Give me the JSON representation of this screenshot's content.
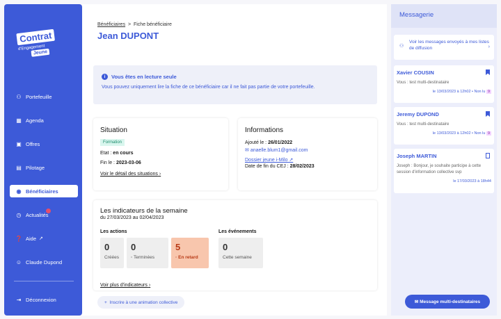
{
  "logo": {
    "line1": "Contrat",
    "line2": "d'Engagement",
    "line3": "Jeune"
  },
  "nav": {
    "items": [
      {
        "label": "Portefeuille",
        "icon": "users-icon"
      },
      {
        "label": "Agenda",
        "icon": "calendar-icon"
      },
      {
        "label": "Offres",
        "icon": "offers-icon"
      },
      {
        "label": "Pilotage",
        "icon": "dashboard-icon"
      },
      {
        "label": "Bénéficiaires",
        "icon": "radio-icon"
      },
      {
        "label": "Actualités",
        "icon": "clock-icon"
      },
      {
        "label": "Aide",
        "icon": "help-icon"
      },
      {
        "label": "Claude Dupond",
        "icon": "profile-icon"
      }
    ],
    "logout": "Déconnexion"
  },
  "breadcrumb": {
    "parent": "Bénéficiaires",
    "current": "Fiche bénéficiaire"
  },
  "page_title": "Jean DUPONT",
  "readonly": {
    "heading": "Vous êtes en lecture seule",
    "text": "Vous pouvez uniquement lire la fiche de ce bénéficiaire car il ne fait pas partie de votre portefeuille."
  },
  "situation": {
    "title": "Situation",
    "tag": "Formation",
    "etat_label": "Etat : ",
    "etat_value": "en cours",
    "fin_label": "Fin le : ",
    "fin_value": "2023-03-06",
    "link": "Voir le détail des situations"
  },
  "informations": {
    "title": "Informations",
    "added_label": "Ajouté le : ",
    "added_value": "26/01/2022",
    "email": "anaelle.blum1@gmail.com",
    "dossier": "Dossier jeune i-Milo",
    "fin_cej_label": "Date de fin du CEJ : ",
    "fin_cej_value": "28/02/2023"
  },
  "indicateurs": {
    "title": "Les indicateurs de la semaine",
    "period": "du 27/03/2023 au 02/04/2023",
    "actions_label": "Les actions",
    "events_label": "Les événements",
    "tiles": [
      {
        "num": "0",
        "label": "Créées"
      },
      {
        "num": "0",
        "label": "Terminées"
      },
      {
        "num": "5",
        "label": "En retard"
      },
      {
        "num": "0",
        "label": "Cette semaine"
      }
    ],
    "more": "Voir plus d'indicateurs"
  },
  "anim_button": "Inscrire à une animation collective",
  "messagerie": {
    "title": "Messagerie",
    "diffusion": "Voir les messages envoyés à mes listes de diffusion",
    "conversations": [
      {
        "name": "Xavier COUSIN",
        "text": "Vous : test multi-destinataire",
        "meta": "le 13/03/2023 à 12h02 • Non lu",
        "count": "9",
        "flag": "filled"
      },
      {
        "name": "Jeremy DUPOND",
        "text": "Vous : test multi-destinataire",
        "meta": "le 13/03/2023 à 12h02 • Non lu",
        "count": "9",
        "flag": "filled"
      },
      {
        "name": "Joseph MARTIN",
        "text": "Joseph : Bonjour, je souhaite participe à cette session d'information collective svp",
        "meta": "le 17/03/2023 à 18h44",
        "count": "",
        "flag": "empty"
      }
    ],
    "multi_button": "Message multi-destinataires"
  }
}
